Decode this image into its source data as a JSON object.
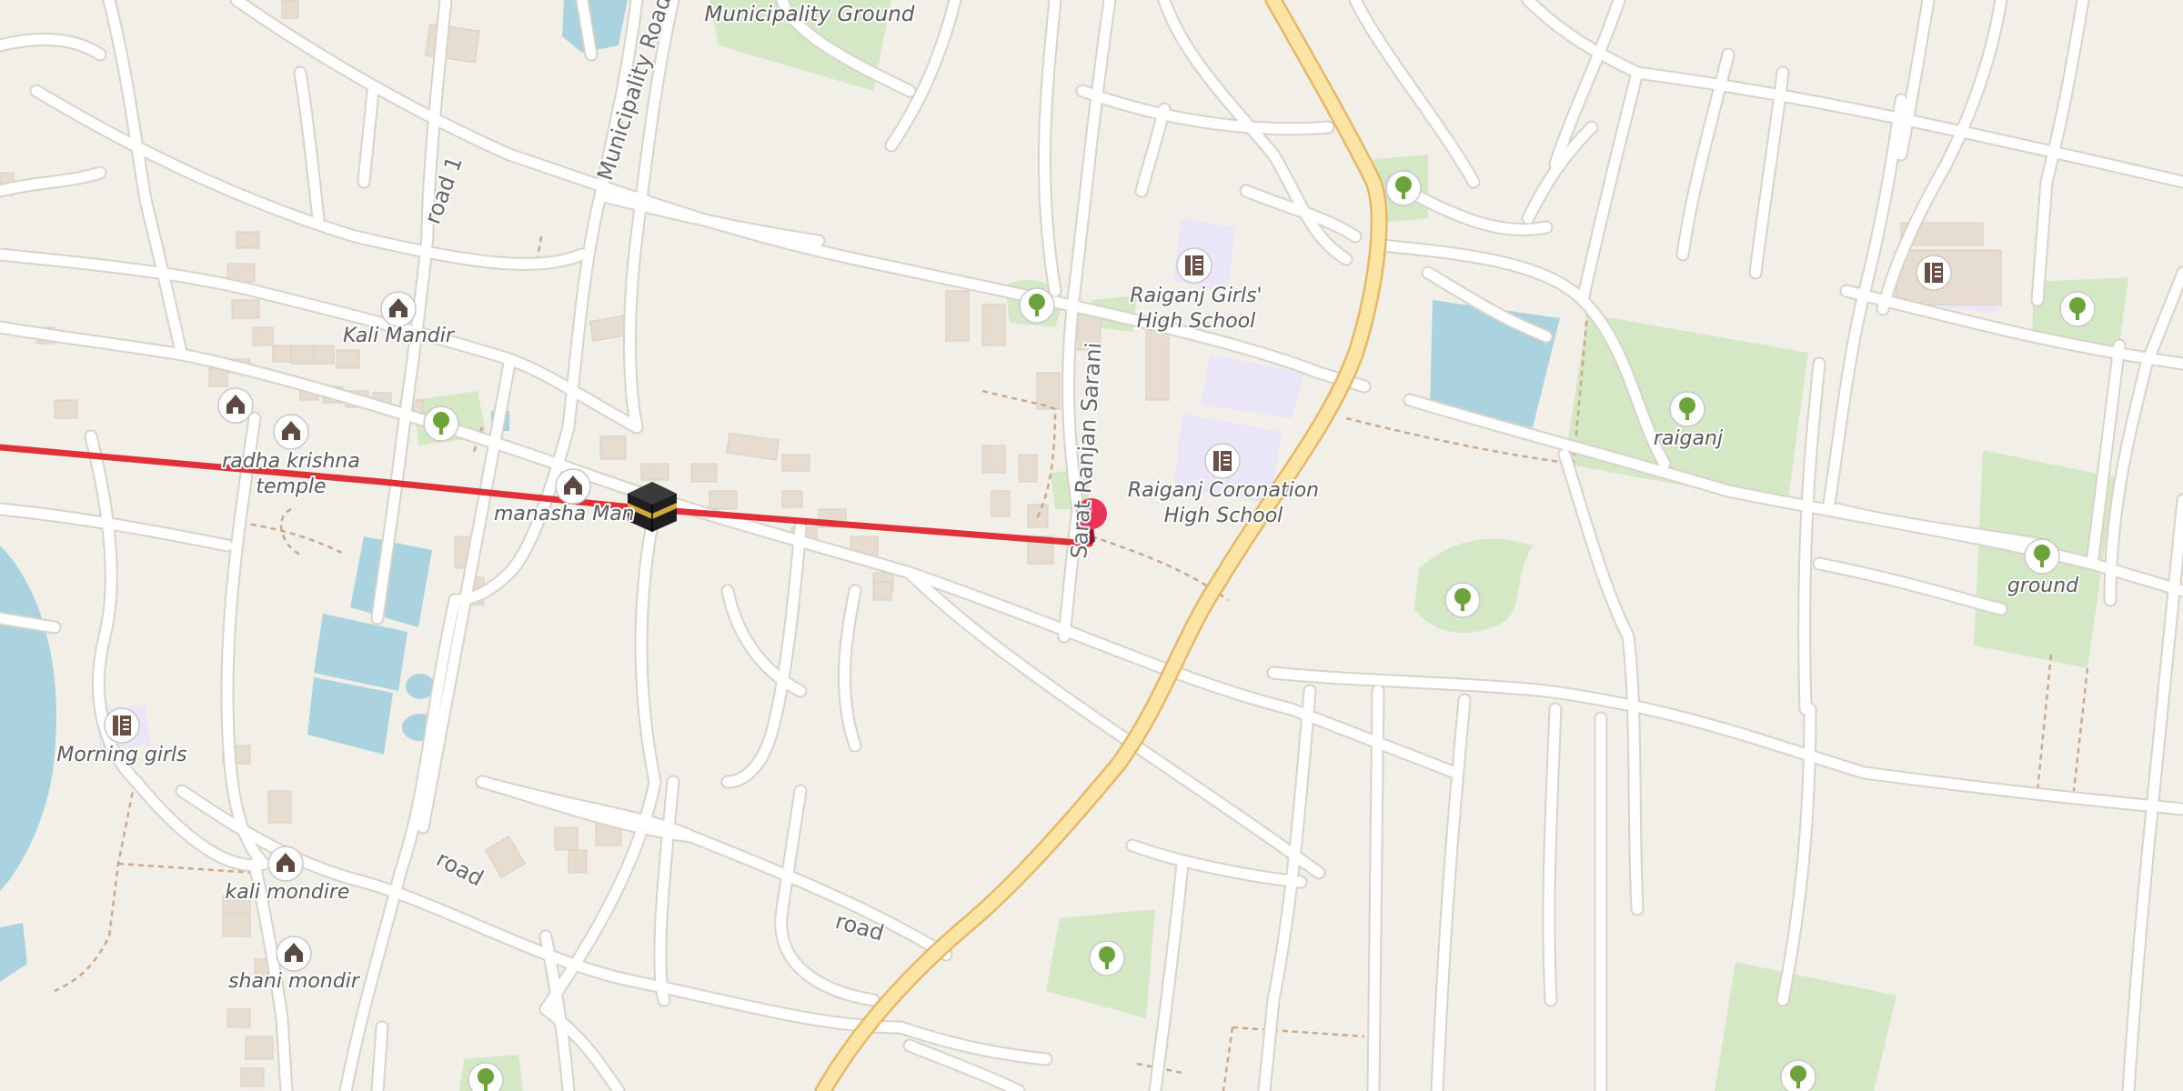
{
  "map": {
    "colors": {
      "background": "#f2efe9",
      "road": "#ffffff",
      "road_casing": "#d8d2c8",
      "primary_road": "#fce5a4",
      "primary_casing": "#e4b86a",
      "water": "#aad3df",
      "park": "#d4e8c6",
      "school_area": "#ebe6f7",
      "building": "#e6ddd0",
      "route_line": "#e03038",
      "pin": "#e8345a",
      "path": "#c9a98a"
    },
    "labels": {
      "municipality_ground": "Municipality Ground",
      "municipality_road": "Municipality Road",
      "road_1": "road 1",
      "kali_mandir": "Kali Mandir",
      "radha_krishna_1": "radha krishna",
      "radha_krishna_2": "temple",
      "manasha": "manasha Man",
      "girls_school_1": "Raiganj Girls'",
      "girls_school_2": "High School",
      "coronation_1": "Raiganj Coronation",
      "coronation_2": "High School",
      "sarani": "Sarat Ranjan Sarani",
      "raiganj": "raiganj",
      "ground": "ground",
      "morning_girls": "Morning girls",
      "kali_mondire": "kali mondire",
      "shani_mondir": "shani mondir",
      "road_a": "road",
      "road_b": "road"
    },
    "icons": {
      "temple": "hindu-temple-icon",
      "school": "school-icon",
      "park": "tree-icon",
      "mosque": "kaaba-icon",
      "pin": "map-pin-icon"
    }
  }
}
